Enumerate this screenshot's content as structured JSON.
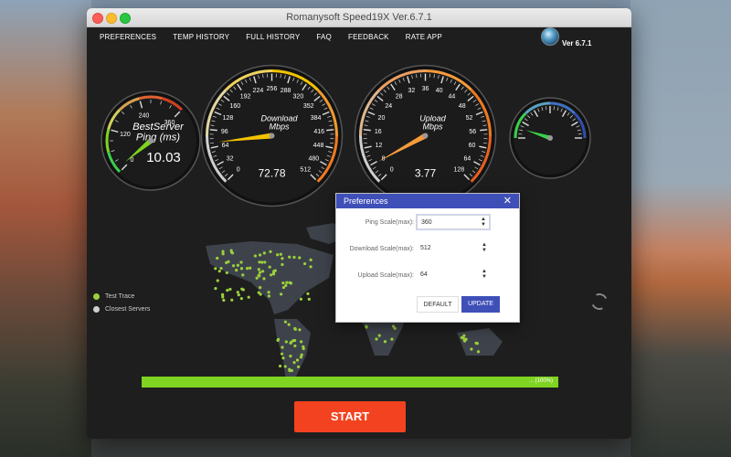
{
  "window": {
    "title": "Romanysoft Speed19X Ver.6.7.1"
  },
  "menu": [
    "PREFERENCES",
    "TEMP HISTORY",
    "FULL HISTORY",
    "FAQ",
    "FEEDBACK",
    "RATE APP"
  ],
  "version": "Ver 6.7.1",
  "ping_gauge": {
    "ticks": [
      "0",
      "120",
      "240",
      "360"
    ],
    "label_1": "BestServer",
    "label_2": "Ping (ms)",
    "value": "10.03",
    "fraction": 0.03,
    "color": "#7fd321"
  },
  "download_gauge": {
    "ticks": [
      "0",
      "32",
      "64",
      "96",
      "128",
      "160",
      "192",
      "224",
      "256",
      "288",
      "320",
      "352",
      "384",
      "416",
      "448",
      "480",
      "512"
    ],
    "label_1": "Download",
    "label_2": "Mbps",
    "value": "72.78",
    "fraction": 0.142,
    "color": "#f4c300"
  },
  "upload_gauge": {
    "ticks": [
      "0",
      "8",
      "12",
      "16",
      "20",
      "24",
      "28",
      "32",
      "36",
      "40",
      "44",
      "48",
      "52",
      "56",
      "60",
      "64",
      "128"
    ],
    "label_1": "Upload",
    "label_2": "Mbps",
    "value": "3.77",
    "fraction": 0.06,
    "color": "#f59b3c"
  },
  "extra_gauge": {
    "color": "#3ad04a"
  },
  "dialog": {
    "title": "Preferences",
    "close": "✕",
    "fields": [
      {
        "label": "Ping Scale(max):",
        "value": "360"
      },
      {
        "label": "Download Scale(max):",
        "value": "512"
      },
      {
        "label": "Upload Scale(max):",
        "value": "64"
      }
    ],
    "default_label": "DEFAULT",
    "update_label": "UPDATE"
  },
  "legend": {
    "test_trace": "Test Trace",
    "closest_servers": "Closest Servers"
  },
  "progress": {
    "text": "... (100%)",
    "fraction": 1.0
  },
  "start_label": "START",
  "colors": {
    "accent": "#3f4fb8",
    "start": "#f3421f",
    "progress": "#7fd321"
  }
}
